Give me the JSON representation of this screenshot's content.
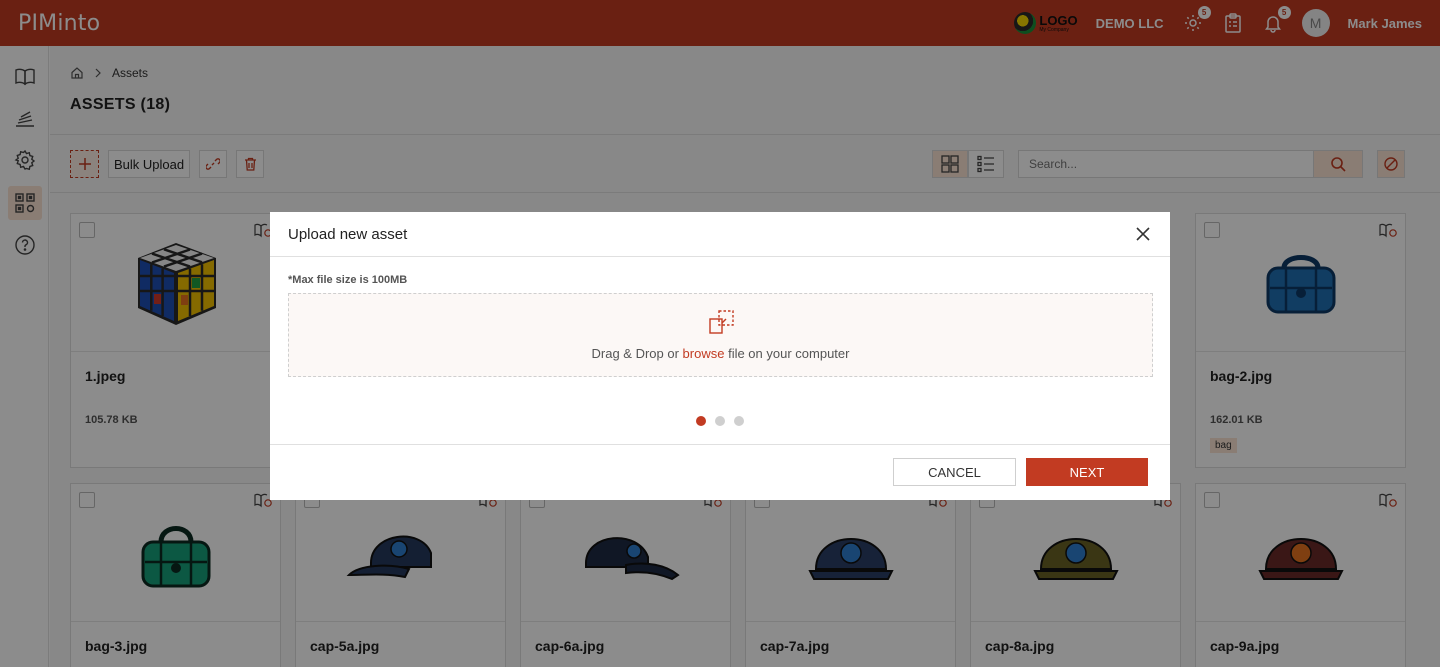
{
  "header": {
    "brand": "PIMinto",
    "logo_text": "LOGO",
    "logo_sub": "My Company",
    "company": "DEMO LLC",
    "badge_tasks": "5",
    "badge_notifications": "5",
    "avatar_initial": "M",
    "user_name": "Mark James",
    "accent_color": "#c23b22"
  },
  "breadcrumb": {
    "current": "Assets"
  },
  "page": {
    "title": "ASSETS (18)"
  },
  "toolbar": {
    "bulk_upload": "Bulk Upload",
    "search_placeholder": "Search..."
  },
  "assets": [
    {
      "name": "1.jpeg",
      "size": "105.78 KB",
      "tag": ""
    },
    {
      "name": "bag-2.jpg",
      "size": "162.01 KB",
      "tag": "bag"
    },
    {
      "name": "bag-3.jpg",
      "size": "",
      "tag": ""
    },
    {
      "name": "cap-5a.jpg",
      "size": "",
      "tag": ""
    },
    {
      "name": "cap-6a.jpg",
      "size": "",
      "tag": ""
    },
    {
      "name": "cap-7a.jpg",
      "size": "",
      "tag": ""
    },
    {
      "name": "cap-8a.jpg",
      "size": "",
      "tag": ""
    },
    {
      "name": "cap-9a.jpg",
      "size": "",
      "tag": ""
    }
  ],
  "modal": {
    "title": "Upload new asset",
    "max_size_note": "*Max file size is 100MB",
    "drop_text_before": "Drag & Drop or ",
    "drop_link": "browse",
    "drop_text_after": " file on your computer",
    "cancel_label": "CANCEL",
    "next_label": "NEXT",
    "step_current": 1,
    "step_total": 3
  }
}
